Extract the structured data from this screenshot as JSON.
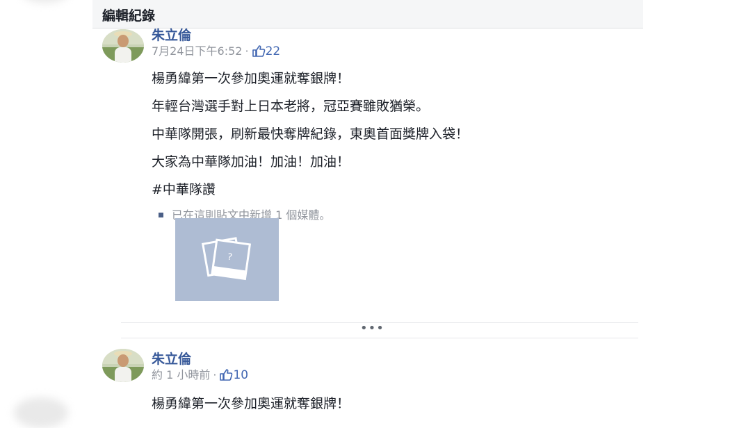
{
  "dialog": {
    "title": "編輯紀錄"
  },
  "entries": [
    {
      "author": "朱立倫",
      "timestamp": "7月24日下午6:52",
      "separator": "·",
      "likes": "22",
      "lines": [
        "楊勇緯第一次參加奧運就奪銀牌！",
        "年輕台灣選手對上日本老將，冠亞賽雖敗猶榮。",
        "中華隊開張，刷新最快奪牌紀錄，東奧首面獎牌入袋！",
        "大家為中華隊加油！加油！加油！",
        "#中華隊讚"
      ],
      "media_notice": "已在這則貼文中新增 1 個媒體。",
      "media_placeholder_glyph": "?"
    },
    {
      "author": "朱立倫",
      "timestamp": "約 1 小時前",
      "separator": "·",
      "likes": "10",
      "first_line": "楊勇緯第一次參加奧運就奪銀牌！"
    }
  ],
  "more_glyph": "•••",
  "icons": {
    "like": "thumbs-up-icon",
    "media": "photo-placeholder-icon",
    "more": "more-dots-icon"
  },
  "colors": {
    "name": "#365899",
    "like": "#4267b2",
    "muted": "#90949c",
    "media_bg": "#aebcd3"
  }
}
